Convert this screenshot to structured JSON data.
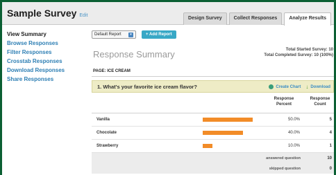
{
  "header": {
    "title": "Sample Survey",
    "edit_label": "Edit",
    "tabs": [
      {
        "label": "Design Survey"
      },
      {
        "label": "Collect Responses"
      },
      {
        "label": "Analyze Results"
      }
    ]
  },
  "sidebar": {
    "items": [
      {
        "label": "View Summary"
      },
      {
        "label": "Browse Responses"
      },
      {
        "label": "Filter Responses"
      },
      {
        "label": "Crosstab Responses"
      },
      {
        "label": "Download Responses"
      },
      {
        "label": "Share Responses"
      }
    ]
  },
  "controls": {
    "report_select": "Default Report",
    "add_report_label": "+ Add Report"
  },
  "summary": {
    "title": "Response Summary",
    "total_started": "Total Started Survey: 10",
    "total_completed": "Total Completed Survey: 10  (100%)"
  },
  "page_label": "PAGE: ICE CREAM",
  "question": {
    "text": "1. What's your favorite ice cream flavor?",
    "create_chart_label": "Create Chart",
    "download_label": "Download"
  },
  "table": {
    "col_percent": [
      "Response",
      "Percent"
    ],
    "col_count": [
      "Response",
      "Count"
    ],
    "rows": [
      {
        "label": "Vanilla",
        "percent": "50.0%",
        "fraction": 0.5,
        "count": "5"
      },
      {
        "label": "Chocolate",
        "percent": "40.0%",
        "fraction": 0.4,
        "count": "4"
      },
      {
        "label": "Strawberry",
        "percent": "10.0%",
        "fraction": 0.1,
        "count": "1"
      }
    ],
    "answered_label": "answered question",
    "answered_value": "10",
    "skipped_label": "skipped question",
    "skipped_value": "0"
  },
  "colors": {
    "bar": "#f28c28",
    "frame": "#0b5f33",
    "link": "#2e7fb4"
  }
}
